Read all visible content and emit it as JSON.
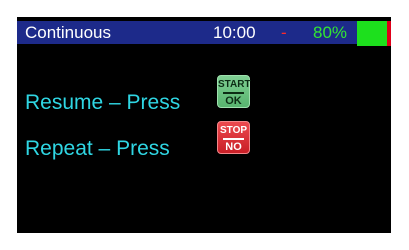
{
  "status_bar": {
    "mode": "Continuous",
    "time": "10:00",
    "separator": "-",
    "battery_percent": "80%",
    "battery_level": 0.8,
    "battery_icon": "battery-icon"
  },
  "rows": [
    {
      "text": "Resume – Press",
      "key_top": "START",
      "key_bottom": "OK",
      "key_icon": "start-ok-key-icon",
      "key_color": "#5fbb78"
    },
    {
      "text": "Repeat – Press",
      "key_top": "STOP",
      "key_bottom": "NO",
      "key_icon": "stop-no-key-icon",
      "key_color": "#d8272d"
    }
  ],
  "colors": {
    "screen_bg": "#000000",
    "status_bar_bg": "#1d2a8a",
    "row_text": "#2fd6e3",
    "battery_green": "#1de01d",
    "battery_red": "#e0001a",
    "separator": "#ff2a2a"
  }
}
